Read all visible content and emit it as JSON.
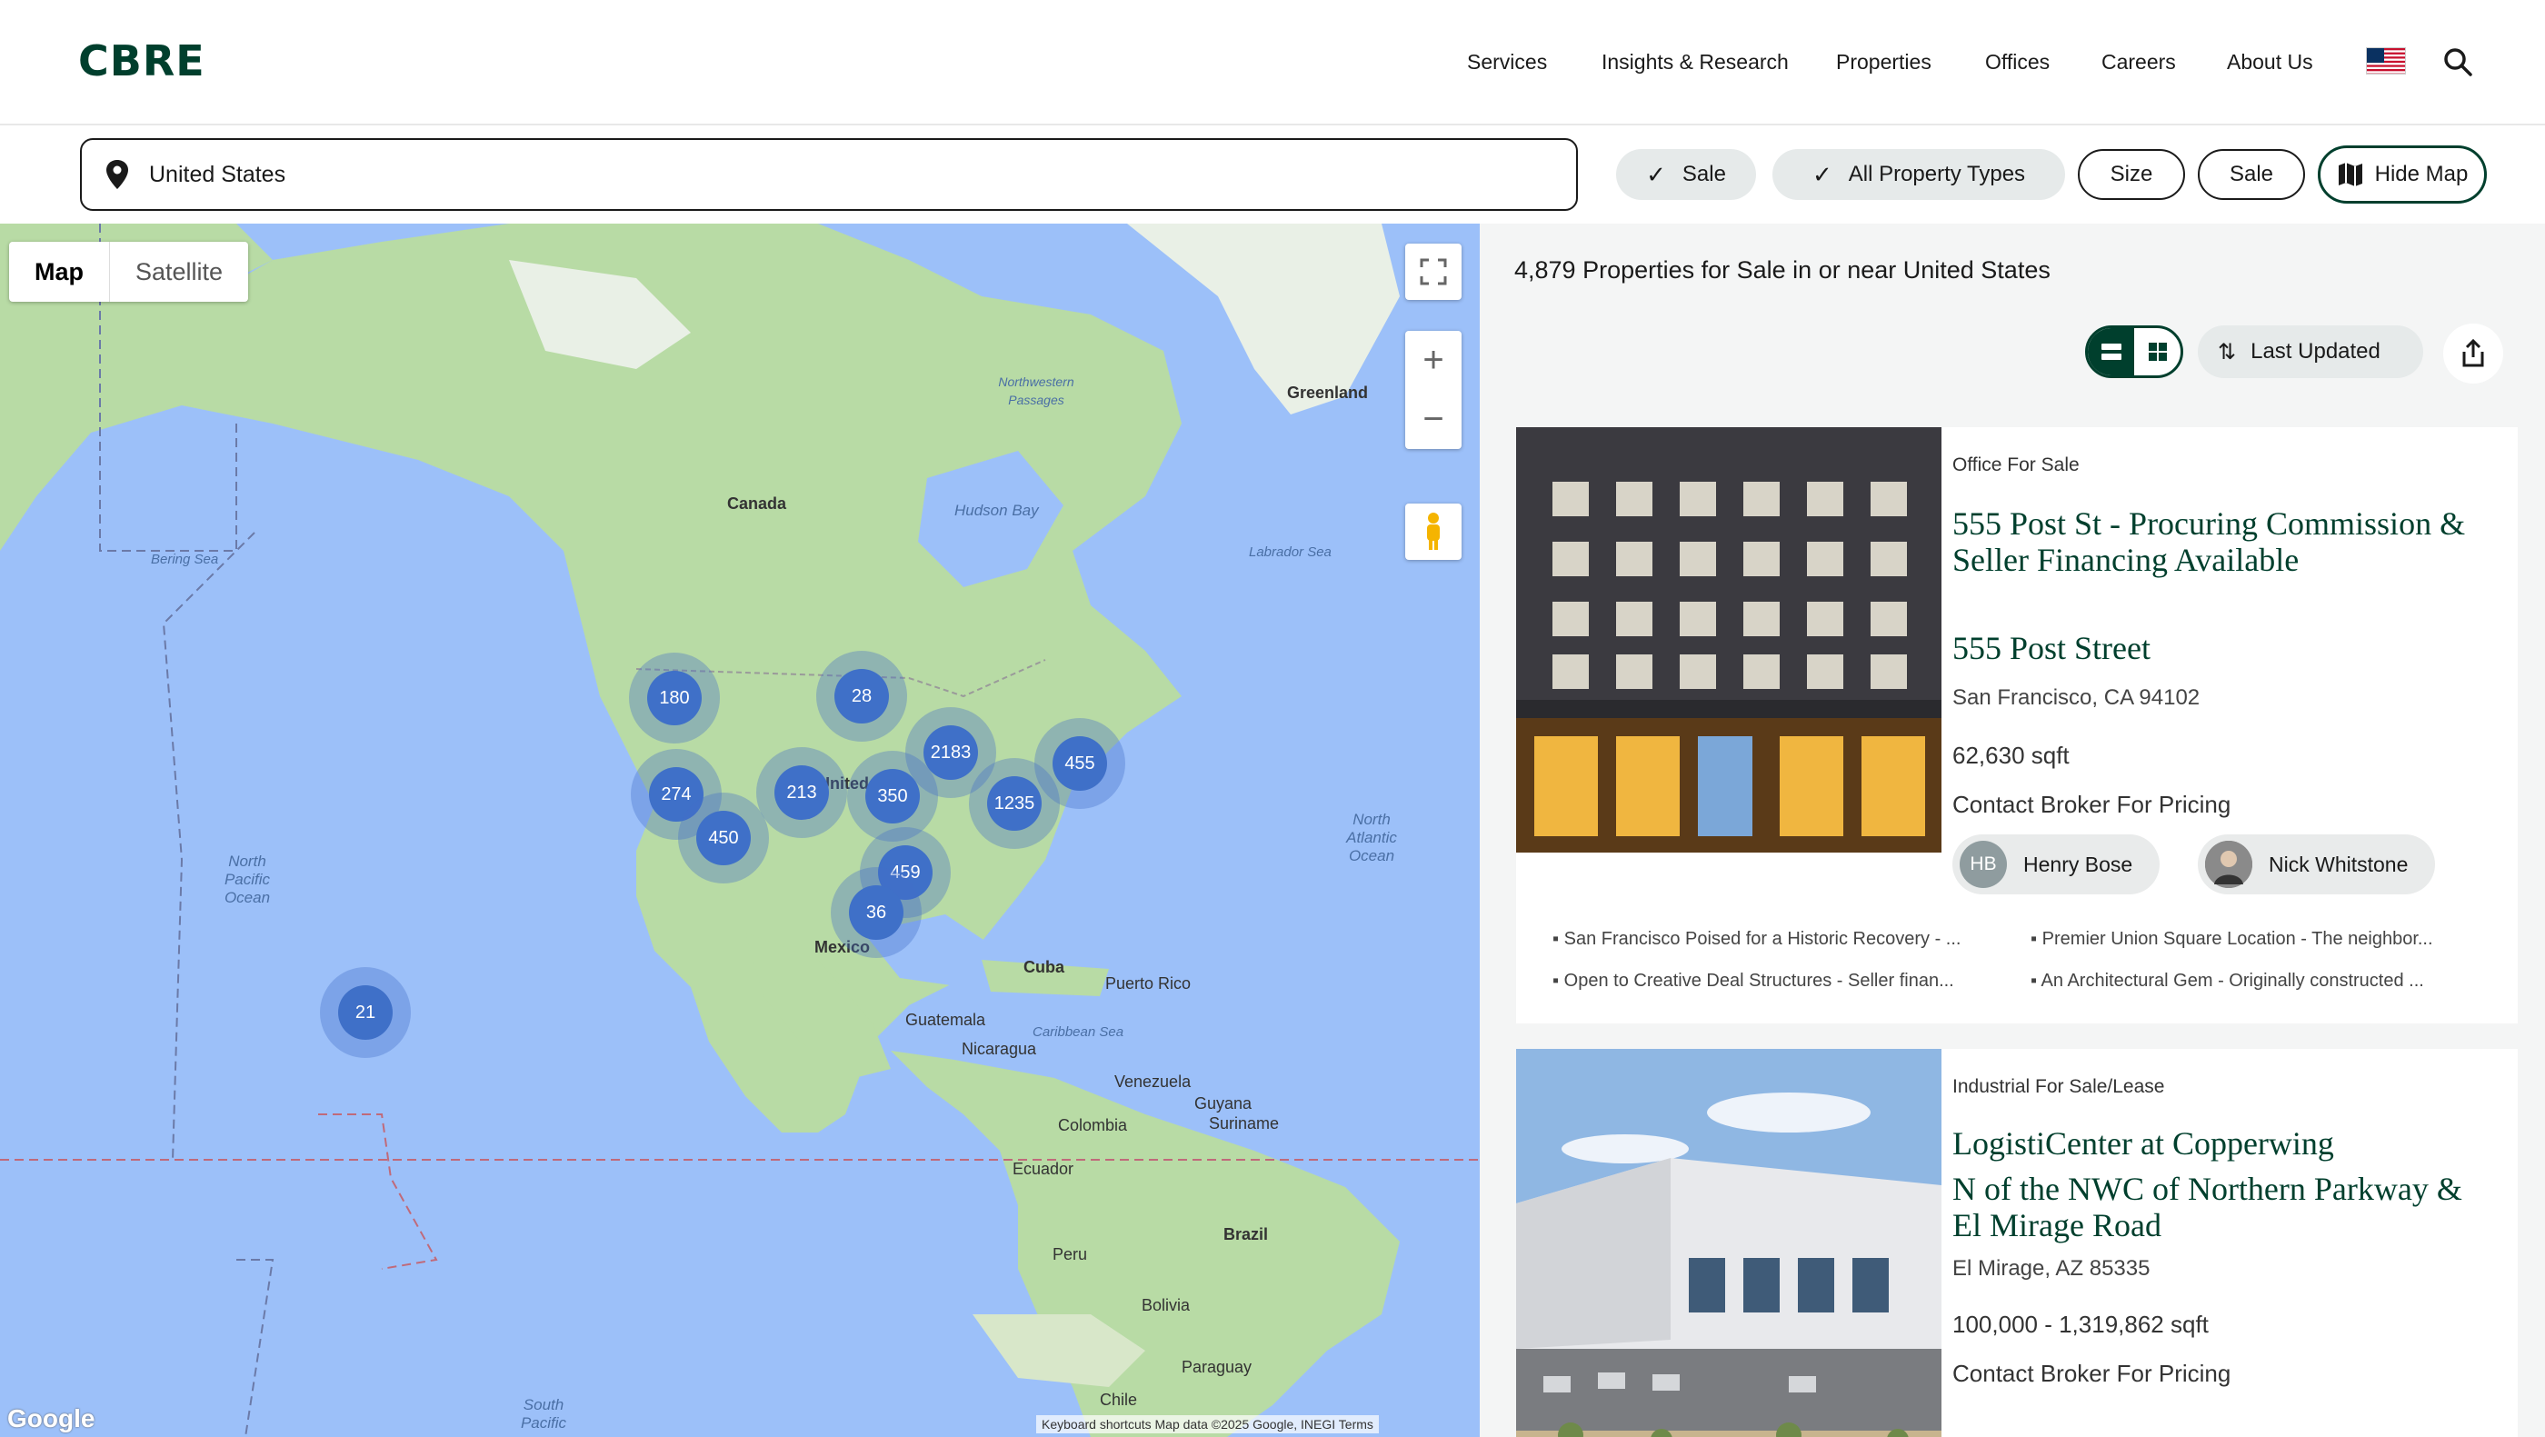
{
  "header": {
    "logo": "CBRE",
    "nav": [
      "Services",
      "Insights & Research",
      "Properties",
      "Offices",
      "Careers",
      "About Us"
    ],
    "flag_icon": "us-flag-icon",
    "search_icon": "search-icon"
  },
  "filters": {
    "location_value": "United States",
    "location_icon": "location-pin-icon",
    "pills": [
      {
        "label": "Sale",
        "checked": true
      },
      {
        "label": "All Property Types",
        "checked": true
      },
      {
        "label": "Size",
        "checked": false
      },
      {
        "label": "Sale",
        "checked": false
      },
      {
        "label": "Hide Map",
        "icon": "map-icon"
      }
    ]
  },
  "map": {
    "toggle": [
      "Map",
      "Satellite"
    ],
    "labels": {
      "greenland": "Greenland",
      "canada": "Canada",
      "hudson": "Hudson Bay",
      "labrador": "Labrador Sea",
      "bering": "Bering Sea",
      "northwest": "Northwestern Passages",
      "united": "United St",
      "mexico": "Mexico",
      "cuba": "Cuba",
      "puerto": "Puerto Rico",
      "guatemala": "Guatemala",
      "nicaragua": "Nicaragua",
      "caribbean": "Caribbean Sea",
      "venezuela": "Venezuela",
      "guyana": "Guyana",
      "suriname": "Suriname",
      "colombia": "Colombia",
      "ecuador": "Ecuador",
      "peru": "Peru",
      "brazil": "Brazil",
      "bolivia": "Bolivia",
      "paraguay": "Paraguay",
      "chile": "Chile",
      "north_pacific": "North Pacific Ocean",
      "north_atlantic": "North Atlantic Ocean",
      "south_pacific": "South Pacific"
    },
    "clusters": [
      "180",
      "28",
      "2183",
      "455",
      "274",
      "213",
      "350",
      "1235",
      "450",
      "459",
      "36",
      "21"
    ],
    "footer": "Keyboard shortcuts   Map data ©2025 Google, INEGI   Terms",
    "google": "Google"
  },
  "results": {
    "count_text": "4,879 Properties for Sale in or near United States",
    "sort_label": "Last Updated"
  },
  "listings": [
    {
      "type": "Office For Sale",
      "title": "555 Post St - Procuring Commission & Seller Financing Available",
      "address": "555 Post Street",
      "city": "San Francisco, CA 94102",
      "size": "62,630 sqft",
      "price": "Contact Broker For Pricing",
      "brokers": [
        {
          "initials": "HB",
          "name": "Henry Bose"
        },
        {
          "initials": "",
          "name": "Nick Whitstone"
        }
      ],
      "highlights": [
        "San Francisco Poised for a Historic Recovery - ...",
        "Premier Union Square Location - The neighbor...",
        "Open to Creative Deal Structures - Seller finan...",
        "An Architectural Gem - Originally constructed ..."
      ]
    },
    {
      "type": "Industrial For Sale/Lease",
      "title": "LogistiCenter at Copperwing",
      "address": "N of the NWC of Northern Parkway & El Mirage Road",
      "city": "El Mirage, AZ 85335",
      "size": "100,000 - 1,319,862 sqft",
      "price": "Contact Broker For Pricing"
    }
  ]
}
